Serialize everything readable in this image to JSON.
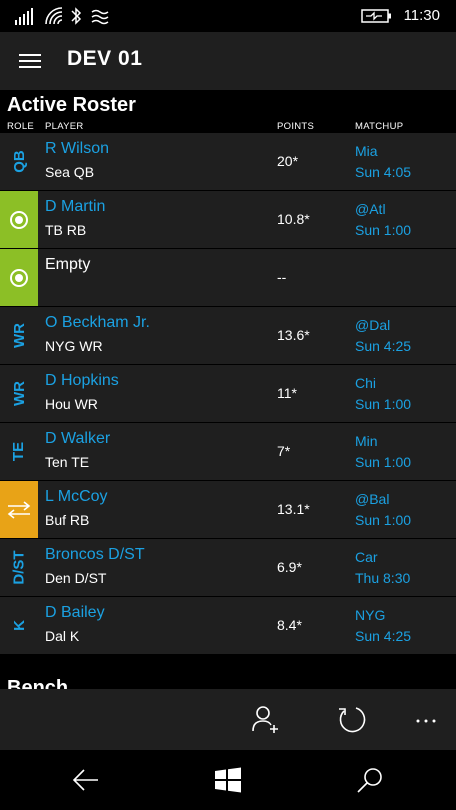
{
  "status": {
    "time": "11:30"
  },
  "header": {
    "title": "DEV 01"
  },
  "roster": {
    "title": "Active Roster",
    "columns": {
      "role": "ROLE",
      "player": "PLAYER",
      "points": "POINTS",
      "matchup": "MATCHUP"
    },
    "rows": [
      {
        "role": "QB",
        "name": "R Wilson",
        "info": "Sea  QB",
        "points": "20*",
        "opp": "Mia",
        "time": "Sun 4:05"
      },
      {
        "role": "",
        "name": "D Martin",
        "info": "TB  RB",
        "points": "10.8*",
        "opp": "@Atl",
        "time": "Sun 1:00"
      },
      {
        "role": "",
        "name": "Empty",
        "info": "",
        "points": "--",
        "opp": "",
        "time": ""
      },
      {
        "role": "WR",
        "name": "O Beckham Jr.",
        "info": "NYG  WR",
        "points": "13.6*",
        "opp": "@Dal",
        "time": "Sun 4:25"
      },
      {
        "role": "WR",
        "name": "D Hopkins",
        "info": "Hou  WR",
        "points": "11*",
        "opp": "Chi",
        "time": "Sun 1:00"
      },
      {
        "role": "TE",
        "name": "D Walker",
        "info": "Ten  TE",
        "points": "7*",
        "opp": "Min",
        "time": "Sun 1:00"
      },
      {
        "role": "",
        "name": "L McCoy",
        "info": "Buf  RB",
        "points": "13.1*",
        "opp": "@Bal",
        "time": "Sun 1:00"
      },
      {
        "role": "D/ST",
        "name": "Broncos D/ST",
        "info": "Den  D/ST",
        "points": "6.9*",
        "opp": "Car",
        "time": "Thu 8:30"
      },
      {
        "role": "K",
        "name": "D Bailey",
        "info": "Dal  K",
        "points": "8.4*",
        "opp": "NYG",
        "time": "Sun 4:25"
      }
    ]
  },
  "bench": {
    "title": "Bench"
  },
  "colors": {
    "accent": "#1ba1e2",
    "flex_green": "#8cbf26",
    "swap_gold": "#e8a317",
    "row_bg": "#1f1f1f"
  },
  "icons": {
    "appbar": [
      "add-player-icon",
      "refresh-icon",
      "more-icon"
    ],
    "navbar": [
      "back-icon",
      "windows-start-icon",
      "search-icon"
    ]
  }
}
